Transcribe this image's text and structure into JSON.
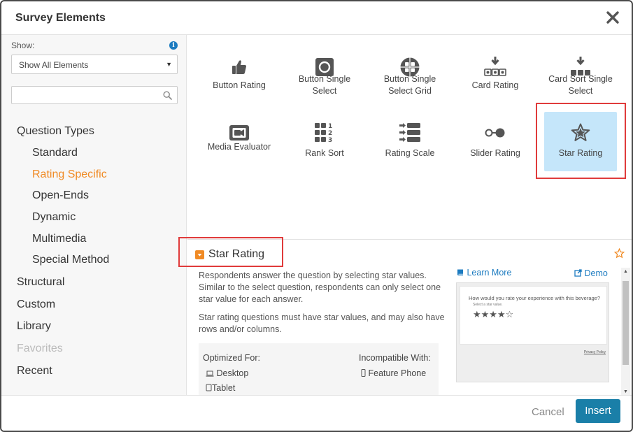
{
  "dialog": {
    "title": "Survey Elements",
    "accent_color": "#f08a24",
    "link_color": "#1c7bc0",
    "highlight_color": "#e03b3b",
    "selected_tile_bg": "#c5e6fa"
  },
  "sidebar": {
    "show_label": "Show:",
    "show_value": "Show All Elements",
    "search_placeholder": "",
    "nav": [
      {
        "label": "Question Types",
        "level": "top"
      },
      {
        "label": "Standard",
        "level": "sub"
      },
      {
        "label": "Rating Specific",
        "level": "sub",
        "active": true
      },
      {
        "label": "Open-Ends",
        "level": "sub"
      },
      {
        "label": "Dynamic",
        "level": "sub"
      },
      {
        "label": "Multimedia",
        "level": "sub"
      },
      {
        "label": "Special Method",
        "level": "sub"
      },
      {
        "label": "Structural",
        "level": "top"
      },
      {
        "label": "Custom",
        "level": "top"
      },
      {
        "label": "Library",
        "level": "top"
      },
      {
        "label": "Favorites",
        "level": "top",
        "disabled": true
      },
      {
        "label": "Recent",
        "level": "top"
      }
    ]
  },
  "elements": [
    {
      "label": "Button Rating",
      "icon": "thumbs-up-icon"
    },
    {
      "label": "Button Single Select",
      "icon": "single-select-button-icon"
    },
    {
      "label": "Button Single Select Grid",
      "icon": "select-grid-icon"
    },
    {
      "label": "Card Rating",
      "icon": "card-rating-icon"
    },
    {
      "label": "Card Sort Single Select",
      "icon": "card-sort-icon"
    },
    {
      "label": "Media Evaluator",
      "icon": "video-camera-icon"
    },
    {
      "label": "Rank Sort",
      "icon": "rank-sort-icon"
    },
    {
      "label": "Rating Scale",
      "icon": "rating-scale-icon"
    },
    {
      "label": "Slider Rating",
      "icon": "slider-icon"
    },
    {
      "label": "Star Rating",
      "icon": "star-icon",
      "selected": true
    }
  ],
  "detail": {
    "title": "Star Rating",
    "description": [
      "Respondents answer the question by selecting star values. Similar to the select question, respondents can only select one star value for each answer.",
      "Star rating questions must have star values, and may also have rows and/or columns."
    ],
    "learn_more": "Learn More",
    "demo": "Demo",
    "optimized_for_label": "Optimized For:",
    "optimized_for": [
      "Desktop",
      "Tablet"
    ],
    "incompatible_label": "Incompatible With:",
    "incompatible": [
      "Feature Phone"
    ],
    "preview": {
      "question": "How would you rate your experience with this beverage?",
      "sub": "Select a star value.",
      "stars_filled": 4,
      "stars_total": 5,
      "policy": "Privacy Policy"
    }
  },
  "footer": {
    "cancel": "Cancel",
    "insert": "Insert"
  }
}
